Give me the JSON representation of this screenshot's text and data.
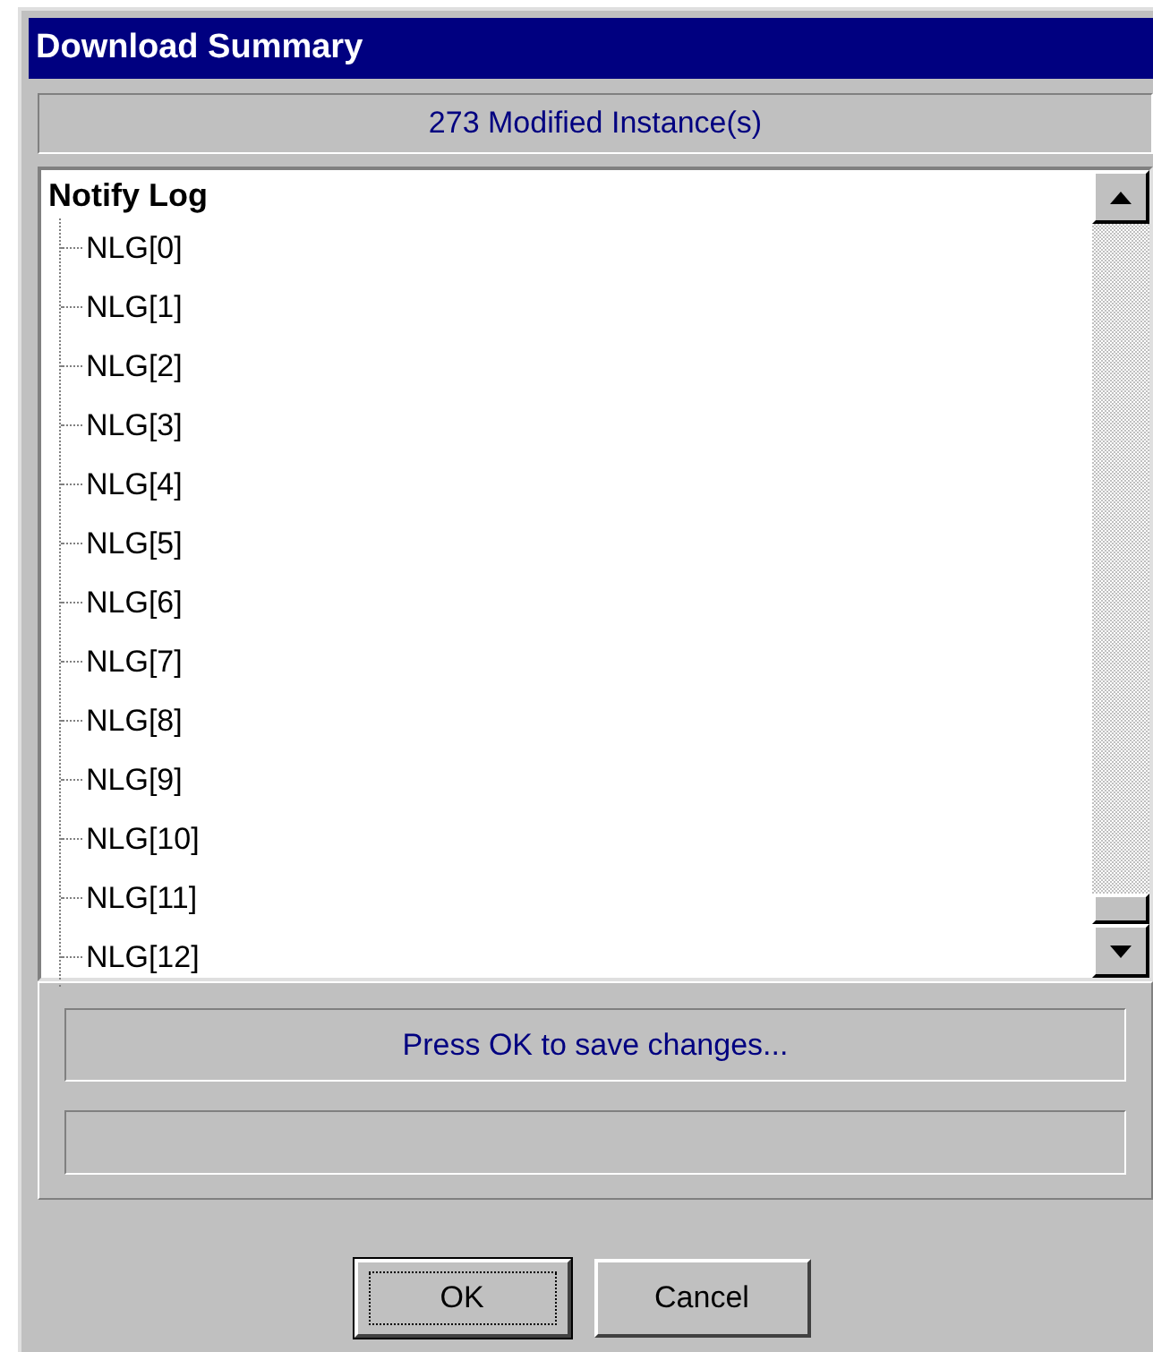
{
  "window": {
    "title": "Download Summary"
  },
  "summary": "273 Modified Instance(s)",
  "tree": {
    "label": "Notify Log",
    "children": [
      {
        "label": "NLG[0]"
      },
      {
        "label": "NLG[1]"
      },
      {
        "label": "NLG[2]"
      },
      {
        "label": "NLG[3]"
      },
      {
        "label": "NLG[4]"
      },
      {
        "label": "NLG[5]"
      },
      {
        "label": "NLG[6]"
      },
      {
        "label": "NLG[7]"
      },
      {
        "label": "NLG[8]"
      },
      {
        "label": "NLG[9]"
      },
      {
        "label": "NLG[10]"
      },
      {
        "label": "NLG[11]"
      },
      {
        "label": "NLG[12]"
      }
    ]
  },
  "status_message": "Press OK to save changes...",
  "progress": {
    "level": 0
  },
  "buttons": [
    {
      "label": "OK",
      "selected": true
    },
    {
      "label": "Cancel",
      "selected": false
    }
  ]
}
